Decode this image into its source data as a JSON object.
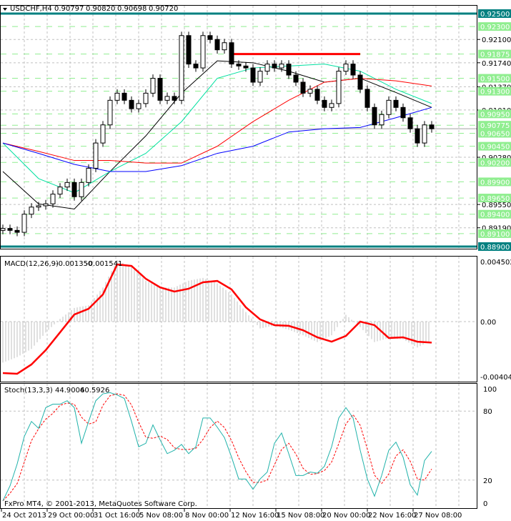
{
  "header": {
    "symbol": "USDCHF,H4",
    "open": "0.90797",
    "high": "0.90820",
    "low": "0.90698",
    "close": "0.90720"
  },
  "macd_header": {
    "label": "MACD(12,26,9)",
    "main": "-0.001350",
    "signal": "-0.001541"
  },
  "stoch_header": {
    "label": "Stoch(13,3,3)",
    "main": "44.9006",
    "signal": "40.5926"
  },
  "copyright": "FxPro MT4, © 2001-2013, MetaQuotes Software Corp.",
  "colors": {
    "level_line": "#008080",
    "level_label": "#90ee90",
    "ma_black": "#000000",
    "ma_green": "#00e0a0",
    "ma_red": "#ff0000",
    "ma_blue": "#0000ff",
    "macd_signal": "#ff0000",
    "stoch_main": "#20b2aa",
    "stoch_signal": "#ff0000",
    "histogram": "#c0c0c0"
  },
  "chart_data": [
    {
      "type": "candlestick",
      "title": "USDCHF,H4",
      "ylim": [
        0.8883,
        0.926
      ],
      "x_tick_labels": [
        "24 Oct 2013",
        "29 Oct 00:00",
        "31 Oct 16:00",
        "5 Nov 08:00",
        "8 Nov 00:00",
        "12 Nov 16:00",
        "15 Nov 08:00",
        "20 Nov 00:00",
        "22 Nov 16:00",
        "27 Nov 08:00"
      ],
      "y_tick_labels": [
        "0.92100",
        "0.91740",
        "0.91370",
        "0.91010",
        "0.90280",
        "0.89550",
        "0.89190"
      ],
      "closes": [
        0.8918,
        0.8915,
        0.8912,
        0.894,
        0.8951,
        0.8953,
        0.8956,
        0.8971,
        0.8982,
        0.8989,
        0.8967,
        0.8989,
        0.9011,
        0.905,
        0.9078,
        0.9116,
        0.9127,
        0.9116,
        0.9103,
        0.9111,
        0.9127,
        0.915,
        0.9116,
        0.9122,
        0.9116,
        0.9216,
        0.9172,
        0.9166,
        0.9216,
        0.921,
        0.9194,
        0.9205,
        0.9172,
        0.9169,
        0.9166,
        0.9144,
        0.9161,
        0.9172,
        0.9166,
        0.9172,
        0.9155,
        0.9144,
        0.9127,
        0.9133,
        0.9116,
        0.9105,
        0.9111,
        0.9161,
        0.9172,
        0.9155,
        0.9133,
        0.9105,
        0.9078,
        0.9094,
        0.9116,
        0.9105,
        0.9089,
        0.9072,
        0.905,
        0.9078,
        0.9072
      ],
      "moving_averages": [
        {
          "name": "MA black",
          "color": "#000000",
          "values": [
            0.9006,
            0.8956,
            0.8948,
            0.9006,
            0.9061,
            0.9127,
            0.9177,
            0.9174,
            0.9161,
            0.9144,
            0.915,
            0.9128,
            0.9105
          ]
        },
        {
          "name": "MA green",
          "color": "#00e0a0",
          "values": [
            0.905,
            0.8995,
            0.8973,
            0.9006,
            0.9034,
            0.9083,
            0.915,
            0.9166,
            0.9169,
            0.9172,
            0.9161,
            0.9133,
            0.9111
          ]
        },
        {
          "name": "MA red",
          "color": "#ff0000",
          "values": [
            0.905,
            0.9037,
            0.9023,
            0.9023,
            0.9019,
            0.9019,
            0.9045,
            0.9083,
            0.9116,
            0.9144,
            0.915,
            0.9146,
            0.9138
          ]
        },
        {
          "name": "MA blue",
          "color": "#0000ff",
          "values": [
            0.905,
            0.9034,
            0.9017,
            0.9006,
            0.9006,
            0.9015,
            0.9034,
            0.9045,
            0.9067,
            0.9072,
            0.9074,
            0.9089,
            0.9105
          ]
        }
      ],
      "horizontal_levels": {
        "teal": [
          "0.92500",
          "0.88900"
        ],
        "green": [
          "0.92300",
          "0.91875",
          "0.91500",
          "0.91300",
          "0.90950",
          "0.90775",
          "0.90650",
          "0.90450",
          "0.90200",
          "0.89900",
          "0.89650",
          "0.89400",
          "0.89100"
        ]
      },
      "resistance_line": {
        "price": 0.91875,
        "from_bar": 32,
        "to_bar": 50
      },
      "current_price": 0.9072
    },
    {
      "type": "line",
      "title": "MACD(12,26,9)",
      "ylim": [
        -0.00404,
        0.004502
      ],
      "y_tick_labels": [
        "0.004502",
        "0.00",
        "-0.00404"
      ],
      "histogram": [
        -0.003,
        -0.0026,
        -0.002,
        -0.0008,
        0.0002,
        0.001,
        0.0012,
        0.0025,
        0.0045,
        0.004,
        0.003,
        0.0025,
        0.0025,
        0.003,
        0.0032,
        0.0028,
        0.002,
        0.0007,
        -0.0005,
        -0.0003,
        -0.0006,
        -0.001,
        -0.0015,
        -0.001,
        0.0005,
        -0.0004,
        -0.0015,
        -0.0012,
        -0.0013,
        -0.0019,
        -0.00135
      ],
      "signal": [
        -0.00377,
        -0.00382,
        -0.00314,
        -0.00209,
        -0.00079,
        0.00052,
        0.00094,
        0.00199,
        0.00419,
        0.00408,
        0.00314,
        0.00251,
        0.0022,
        0.00241,
        0.00288,
        0.00298,
        0.00236,
        0.00105,
        0.00016,
        -0.00026,
        -0.00031,
        -0.00063,
        -0.00115,
        -0.00147,
        -0.00105,
        0.0,
        -0.00026,
        -0.0012,
        -0.00115,
        -0.00147,
        -0.00154
      ]
    },
    {
      "type": "line",
      "title": "Stoch(13,3,3)",
      "ylim": [
        0,
        100
      ],
      "y_tick_labels": [
        "100",
        "80",
        "20",
        "0"
      ],
      "levels": [
        80,
        20
      ],
      "signal_period": 3,
      "main": [
        2,
        15,
        34,
        58,
        71,
        65,
        83,
        86,
        86,
        89,
        83,
        52,
        71,
        89,
        95,
        96,
        94,
        91,
        71,
        49,
        52,
        68,
        55,
        43,
        46,
        51,
        43,
        49,
        74,
        74,
        66,
        57,
        40,
        21,
        21,
        12,
        21,
        27,
        52,
        61,
        43,
        24,
        24,
        27,
        26,
        32,
        49,
        74,
        83,
        74,
        46,
        21,
        6,
        24,
        46,
        53,
        40,
        16,
        7,
        37,
        45
      ]
    }
  ]
}
